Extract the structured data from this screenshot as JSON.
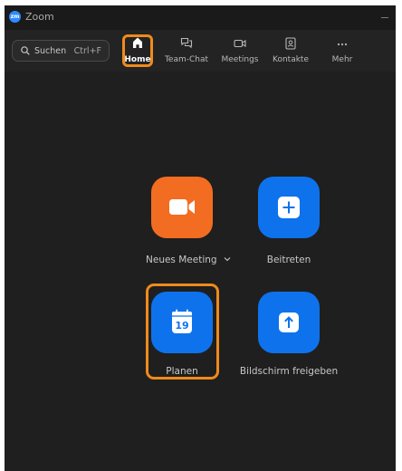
{
  "window": {
    "title": "Zoom",
    "logo_text": "zm"
  },
  "search": {
    "label": "Suchen",
    "shortcut": "Ctrl+F"
  },
  "tabs": [
    {
      "label": "Home",
      "icon": "home-icon",
      "active": true
    },
    {
      "label": "Team-Chat",
      "icon": "chat-icon",
      "active": false
    },
    {
      "label": "Meetings",
      "icon": "video-camera-icon",
      "active": false
    },
    {
      "label": "Kontakte",
      "icon": "contacts-icon",
      "active": false
    },
    {
      "label": "Mehr",
      "icon": "more-icon",
      "active": false
    }
  ],
  "actions": {
    "new_meeting": {
      "label": "Neues Meeting",
      "icon": "video-camera-icon",
      "color": "#f26d21"
    },
    "join": {
      "label": "Beitreten",
      "icon": "plus-icon",
      "color": "#0e72ed"
    },
    "schedule": {
      "label": "Planen",
      "icon": "calendar-icon",
      "day": "19",
      "color": "#0e72ed"
    },
    "share_screen": {
      "label": "Bildschirm freigeben",
      "icon": "arrow-up-icon",
      "color": "#0e72ed"
    }
  },
  "colors": {
    "highlight": "#f08a1c",
    "background": "#1f1f1f"
  }
}
